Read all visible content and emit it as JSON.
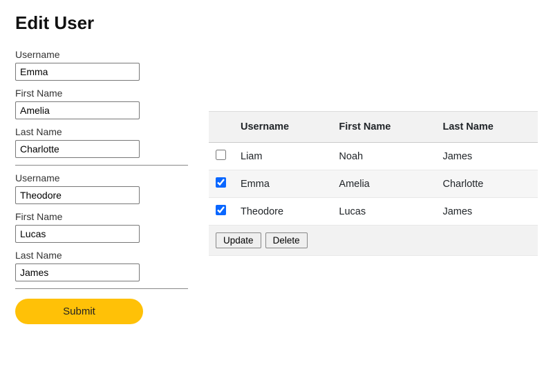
{
  "title": "Edit User",
  "form": {
    "users": [
      {
        "username_label": "Username",
        "username_value": "Emma",
        "firstname_label": "First Name",
        "firstname_value": "Amelia",
        "lastname_label": "Last Name",
        "lastname_value": "Charlotte"
      },
      {
        "username_label": "Username",
        "username_value": "Theodore",
        "firstname_label": "First Name",
        "firstname_value": "Lucas",
        "lastname_label": "Last Name",
        "lastname_value": "James"
      }
    ],
    "submit_label": "Submit"
  },
  "table": {
    "headers": {
      "username": "Username",
      "firstname": "First Name",
      "lastname": "Last Name"
    },
    "rows": [
      {
        "checked": false,
        "username": "Liam",
        "firstname": "Noah",
        "lastname": "James"
      },
      {
        "checked": true,
        "username": "Emma",
        "firstname": "Amelia",
        "lastname": "Charlotte"
      },
      {
        "checked": true,
        "username": "Theodore",
        "firstname": "Lucas",
        "lastname": "James"
      }
    ],
    "actions": {
      "update_label": "Update",
      "delete_label": "Delete"
    }
  }
}
